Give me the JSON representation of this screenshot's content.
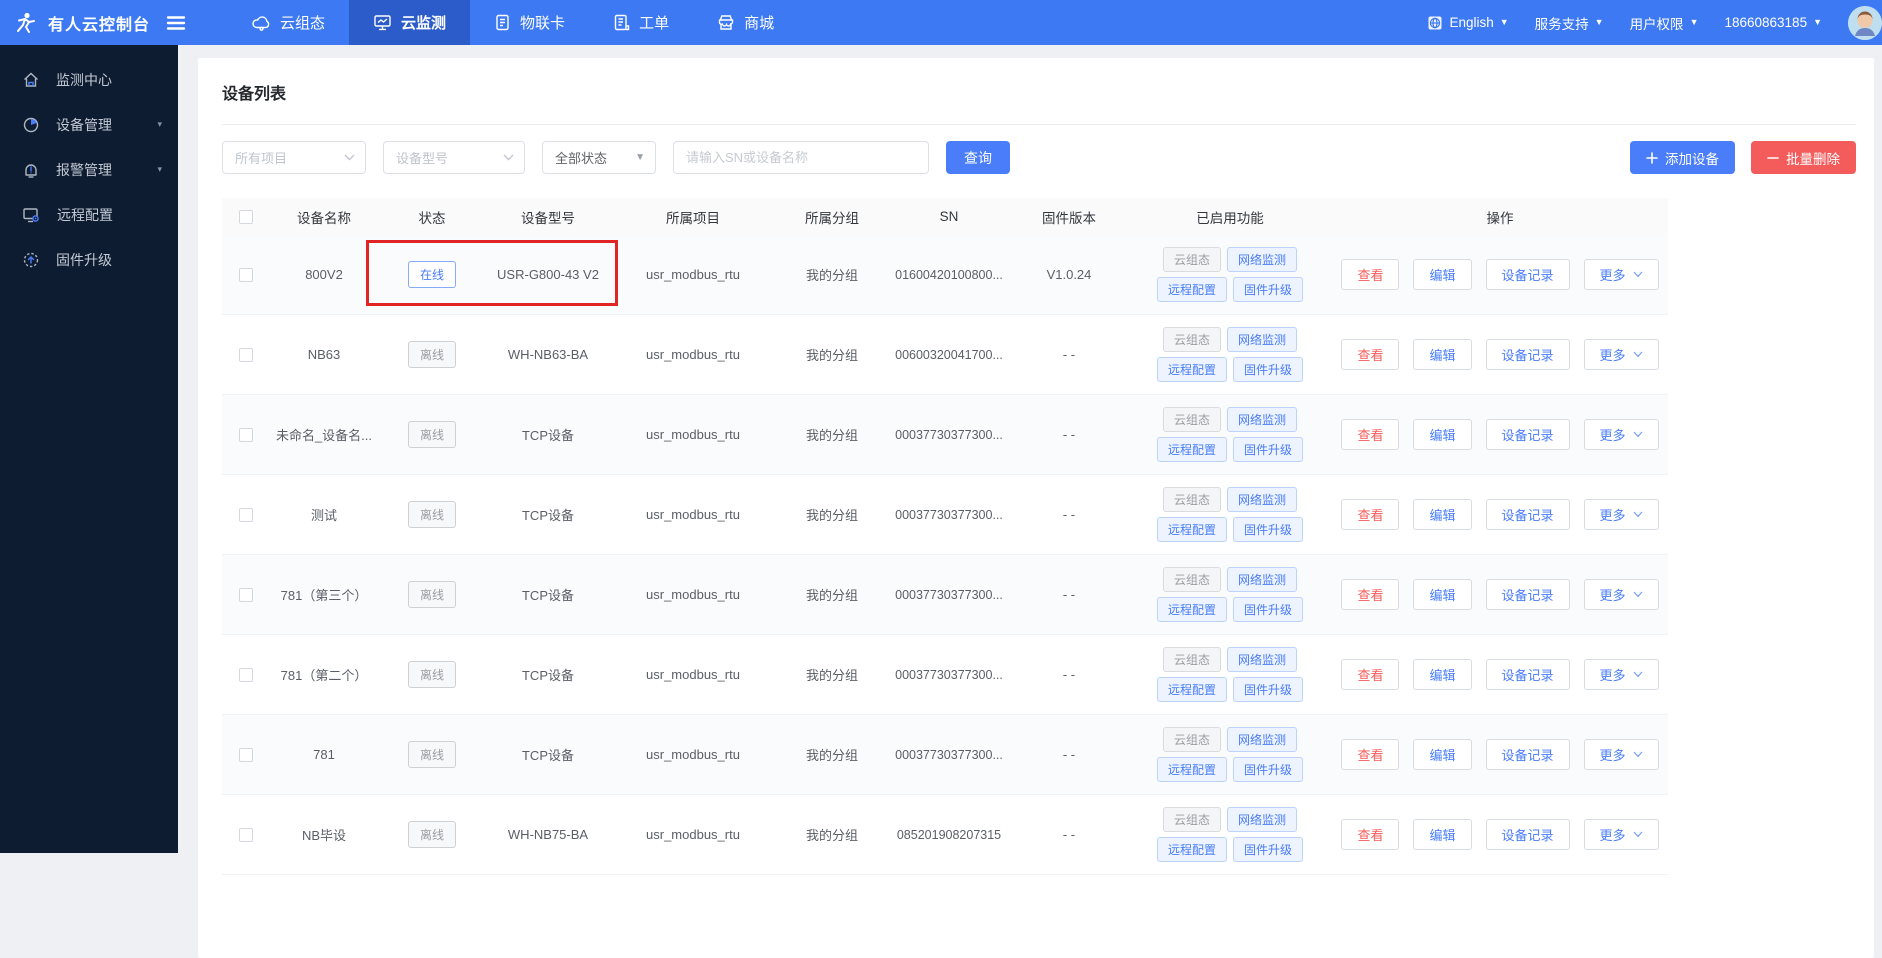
{
  "topbar": {
    "brand": "有人云控制台",
    "tabs": [
      {
        "label": "云组态",
        "icon": "cloud-scada-icon",
        "active": false
      },
      {
        "label": "云监测",
        "icon": "cloud-monitor-icon",
        "active": true
      },
      {
        "label": "物联卡",
        "icon": "iot-card-icon",
        "active": false
      },
      {
        "label": "工单",
        "icon": "work-order-icon",
        "active": false
      },
      {
        "label": "商城",
        "icon": "mall-icon",
        "active": false
      }
    ],
    "language": {
      "icon": "globe-icon",
      "label": "English"
    },
    "links": [
      {
        "label": "服务支持"
      },
      {
        "label": "用户权限"
      }
    ],
    "account": {
      "phone": "18660863185"
    }
  },
  "sidebar": {
    "items": [
      {
        "label": "监测中心",
        "icon": "home-icon",
        "expandable": false
      },
      {
        "label": "设备管理",
        "icon": "device-pie-icon",
        "expandable": true
      },
      {
        "label": "报警管理",
        "icon": "alarm-bell-icon",
        "expandable": true
      },
      {
        "label": "远程配置",
        "icon": "remote-config-icon",
        "expandable": false
      },
      {
        "label": "固件升级",
        "icon": "firmware-upgrade-icon",
        "expandable": false
      }
    ]
  },
  "page": {
    "title": "设备列表",
    "filters": {
      "project_placeholder": "所有项目",
      "model_placeholder": "设备型号",
      "status_value": "全部状态",
      "search_placeholder": "请输入SN或设备名称",
      "query_button": "查询",
      "add_button": "添加设备",
      "delete_button": "批量删除"
    },
    "table": {
      "columns": [
        "设备名称",
        "状态",
        "设备型号",
        "所属项目",
        "所属分组",
        "SN",
        "固件版本",
        "已启用功能",
        "操作"
      ],
      "features": [
        "云组态",
        "网络监测",
        "远程配置",
        "固件升级"
      ],
      "actions": [
        "查看",
        "编辑",
        "设备记录",
        "更多"
      ],
      "rows": [
        {
          "name": "800V2",
          "status": "在线",
          "online": true,
          "model": "USR-G800-43 V2",
          "project": "usr_modbus_rtu",
          "group": "我的分组",
          "sn": "01600420100800...",
          "firmware": "V1.0.24",
          "highlighted": true
        },
        {
          "name": "NB63",
          "status": "离线",
          "online": false,
          "model": "WH-NB63-BA",
          "project": "usr_modbus_rtu",
          "group": "我的分组",
          "sn": "00600320041700...",
          "firmware": "- -",
          "highlighted": false
        },
        {
          "name": "未命名_设备名...",
          "status": "离线",
          "online": false,
          "model": "TCP设备",
          "project": "usr_modbus_rtu",
          "group": "我的分组",
          "sn": "00037730377300...",
          "firmware": "- -",
          "highlighted": false
        },
        {
          "name": "测试",
          "status": "离线",
          "online": false,
          "model": "TCP设备",
          "project": "usr_modbus_rtu",
          "group": "我的分组",
          "sn": "00037730377300...",
          "firmware": "- -",
          "highlighted": false
        },
        {
          "name": "781（第三个）",
          "status": "离线",
          "online": false,
          "model": "TCP设备",
          "project": "usr_modbus_rtu",
          "group": "我的分组",
          "sn": "00037730377300...",
          "firmware": "- -",
          "highlighted": false
        },
        {
          "name": "781（第二个）",
          "status": "离线",
          "online": false,
          "model": "TCP设备",
          "project": "usr_modbus_rtu",
          "group": "我的分组",
          "sn": "00037730377300...",
          "firmware": "- -",
          "highlighted": false
        },
        {
          "name": "781",
          "status": "离线",
          "online": false,
          "model": "TCP设备",
          "project": "usr_modbus_rtu",
          "group": "我的分组",
          "sn": "00037730377300...",
          "firmware": "- -",
          "highlighted": false
        },
        {
          "name": "NB毕设",
          "status": "离线",
          "online": false,
          "model": "WH-NB75-BA",
          "project": "usr_modbus_rtu",
          "group": "我的分组",
          "sn": "085201908207315",
          "firmware": "- -",
          "highlighted": false
        }
      ]
    }
  },
  "colors": {
    "topbar_blue": "#3d79f2",
    "active_tab_blue": "#2b5cc9",
    "sidebar_navy": "#0d1c30",
    "link_blue": "#4a7dfa",
    "danger_red": "#f45c5c",
    "highlight_red": "#e12525",
    "page_bg": "#eef0f3"
  }
}
